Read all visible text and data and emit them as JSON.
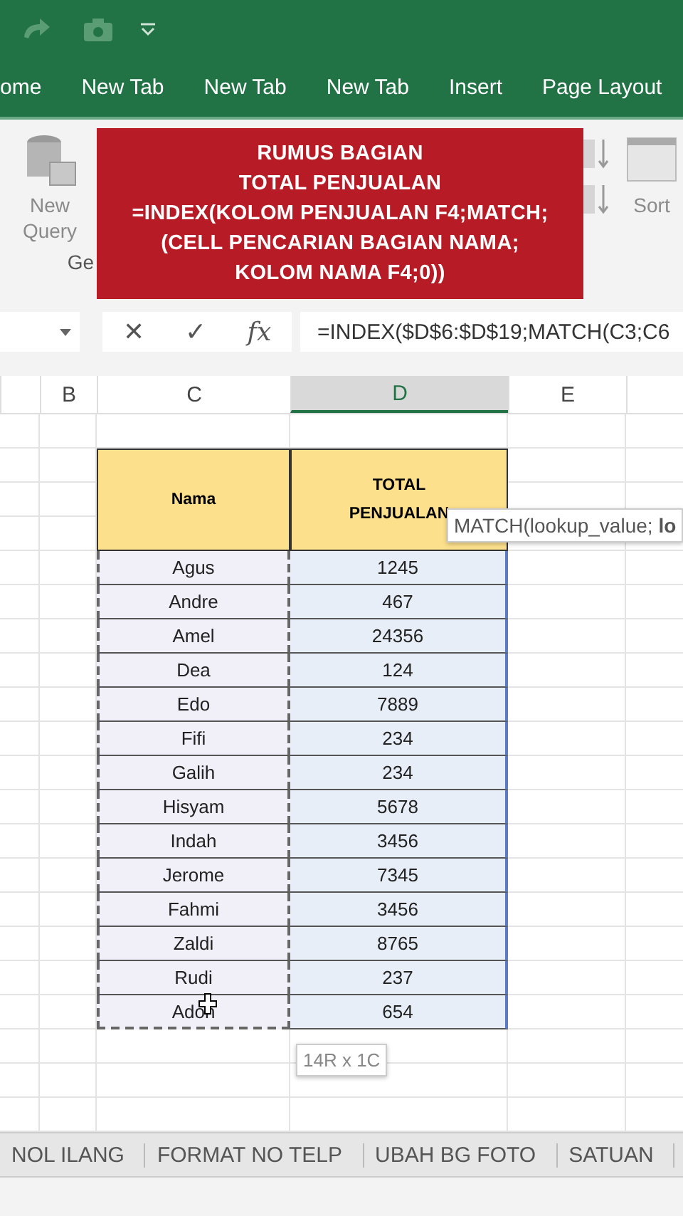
{
  "ribbon_tabs": [
    {
      "label": "ome",
      "selected": false
    },
    {
      "label": "New Tab",
      "selected": false
    },
    {
      "label": "New Tab",
      "selected": false
    },
    {
      "label": "New Tab",
      "selected": false
    },
    {
      "label": "Insert",
      "selected": false
    },
    {
      "label": "Page Layout",
      "selected": false
    }
  ],
  "ribbon": {
    "new_query": [
      "New",
      "Query"
    ],
    "group_label": "Ge",
    "sort_label": "Sort"
  },
  "overlay": {
    "lines": [
      "RUMUS BAGIAN",
      "TOTAL PENJUALAN",
      "=INDEX(KOLOM PENJUALAN F4;MATCH;",
      "(CELL PENCARIAN BAGIAN NAMA;",
      "KOLOM NAMA F4;0))"
    ]
  },
  "formula_bar": {
    "buttons": [
      "✕",
      "✓",
      "fx"
    ],
    "value": "=INDEX($D$6:$D$19;MATCH(C3;C6"
  },
  "columns": [
    {
      "label": "B",
      "selected": false
    },
    {
      "label": "C",
      "selected": false
    },
    {
      "label": "D",
      "selected": true
    },
    {
      "label": "E",
      "selected": false
    }
  ],
  "table": {
    "headers": [
      "Nama",
      "TOTAL\nPENJUALAN"
    ],
    "rows": [
      [
        "Agus",
        "1245"
      ],
      [
        "Andre",
        "467"
      ],
      [
        "Amel",
        "24356"
      ],
      [
        "Dea",
        "124"
      ],
      [
        "Edo",
        "7889"
      ],
      [
        "Fifi",
        "234"
      ],
      [
        "Galih",
        "234"
      ],
      [
        "Hisyam",
        "5678"
      ],
      [
        "Indah",
        "3456"
      ],
      [
        "Jerome",
        "7345"
      ],
      [
        "Fahmi",
        "3456"
      ],
      [
        "Zaldi",
        "8765"
      ],
      [
        "Rudi",
        "237"
      ],
      [
        "Adon",
        "654"
      ]
    ]
  },
  "function_tooltip": "MATCH(lookup_value; **lo**",
  "selection_size": "14R x 1C",
  "sheet_tabs": [
    {
      "label": "NOL ILANG",
      "selected": false
    },
    {
      "label": "FORMAT NO TELP",
      "selected": false
    },
    {
      "label": "UBAH BG FOTO",
      "selected": false
    },
    {
      "label": "SATUAN",
      "selected": false
    }
  ]
}
